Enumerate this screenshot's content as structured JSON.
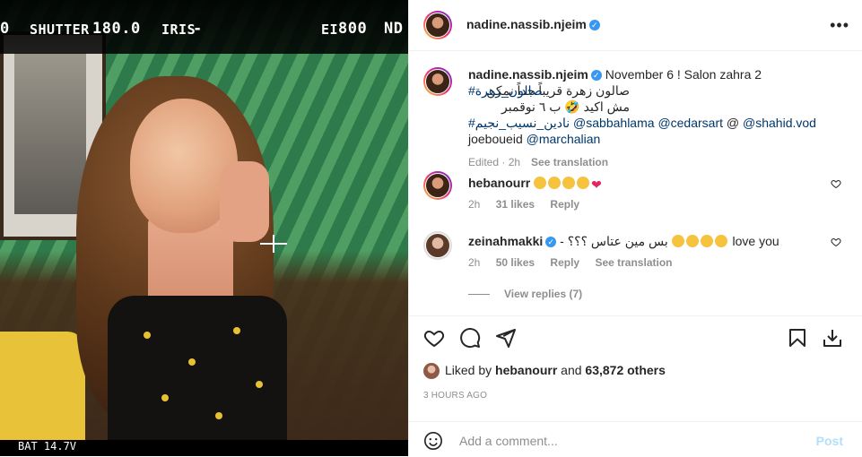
{
  "photo": {
    "hud": {
      "shutter_label": "SHUTTER",
      "shutter_value": "180.0",
      "iris_label": "IRIS",
      "iris_value": "-",
      "ei_label": "EI",
      "ei_value": "800",
      "nd_label": "ND",
      "left_fragment": "0"
    },
    "bottom_text": "BAT 14.7V"
  },
  "post": {
    "author": "nadine.nassib.njeim",
    "caption": {
      "lead": "November 6 ! Salon zahra 2",
      "arabic_line": "صالون زهرة قريباً جداً يمكن مش اكيد 🤣 ب ٦ نوقمبر",
      "hashtag_1": "#صالون_زهرة",
      "hashtag_2": "#نادين_نسيب_نجيم",
      "mention_1": "@sabbahlama",
      "mention_2": "@cedarsart",
      "at": "@",
      "mention_3": "@shahid.vod",
      "plain": "joeboueid",
      "mention_4": "@marchalian",
      "edited": "Edited · 2h",
      "see_translation": "See translation"
    },
    "comments": [
      {
        "user": "hebanourr",
        "time": "2h",
        "likes": "31 likes",
        "reply": "Reply"
      },
      {
        "user": "zeinahmakki",
        "text_arabic": "بس مين عتاس ؟؟؟ -",
        "text_end": "love you",
        "time": "2h",
        "likes": "50 likes",
        "reply": "Reply",
        "see_translation": "See translation"
      }
    ],
    "view_replies": "View replies (7)",
    "liked_by_prefix": "Liked by",
    "liked_by_user": "hebanourr",
    "liked_by_and": "and",
    "liked_by_others": "63,872 others",
    "time_ago": "3 HOURS AGO",
    "add_comment_placeholder": "Add a comment...",
    "post_label": "Post"
  },
  "icons": [
    "more-icon",
    "heart-icon",
    "comment-icon",
    "share-icon",
    "bookmark-icon",
    "download-icon",
    "emoji-icon"
  ],
  "colors": {
    "link": "#00376b",
    "muted": "#8e8e8e",
    "verified": "#3897f0",
    "post_disabled": "#b2dffc"
  }
}
